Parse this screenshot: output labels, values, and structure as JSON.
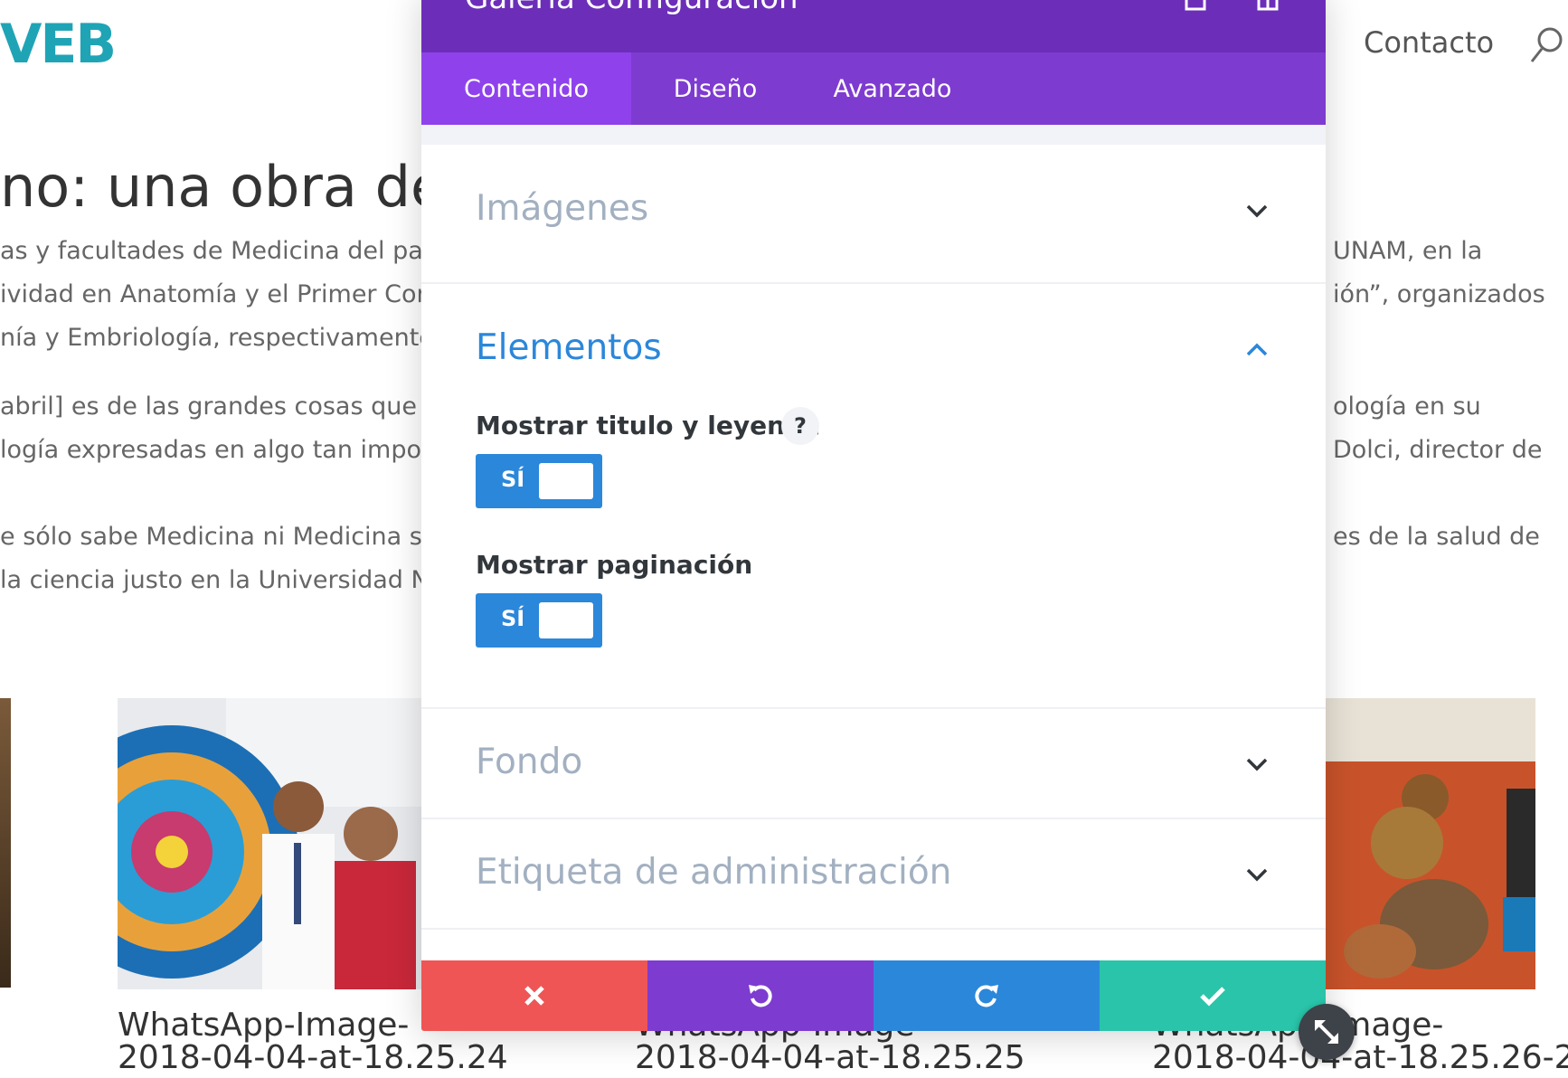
{
  "page": {
    "logo": "VEB",
    "nav_contact": "Contacto",
    "heading": "no: una obra de",
    "paragraphs": [
      "as y facultades de Medicina del país",
      "ividad en Anatomía y el Primer Conc",
      "nía y Embriología, respectivamente.",
      "abril] es de las grandes cosas que h",
      "logía expresadas en algo tan import",
      "e sólo sabe Medicina ni Medicina sab",
      " la ciencia justo en la Universidad Na"
    ],
    "paragraphs_right": [
      "UNAM, en la",
      "ión”, organizados",
      "ología en su",
      "Dolci, director de",
      "es de la salud de"
    ],
    "captions": [
      [
        "WhatsApp-Image-",
        "2018-04-04-at-18.25.24"
      ],
      [
        "WhatsApp-Image-",
        "2018-04-04-at-18.25.25"
      ],
      [
        "WhatsApp-Image-",
        "2018-04-04-at-18.25.26-2"
      ]
    ]
  },
  "modal": {
    "title": "Galería Configuración",
    "tabs": [
      "Contenido",
      "Diseño",
      "Avanzado"
    ],
    "sections": {
      "images": "Imágenes",
      "elements": "Elementos",
      "background": "Fondo",
      "admin_label": "Etiqueta de administración"
    },
    "fields": {
      "show_title": "Mostrar titulo y leyenda",
      "show_pagination": "Mostrar paginación",
      "toggle_on": "SÍ",
      "help": "?"
    }
  },
  "colors": {
    "header": "#6c2eb9",
    "tabs": "#7e3bd0",
    "tab_active": "#8f42ec",
    "accent_blue": "#2b87da",
    "cancel": "#ef5555",
    "undo": "#7e3bd0",
    "redo": "#2b87da",
    "save": "#29c4a9"
  }
}
